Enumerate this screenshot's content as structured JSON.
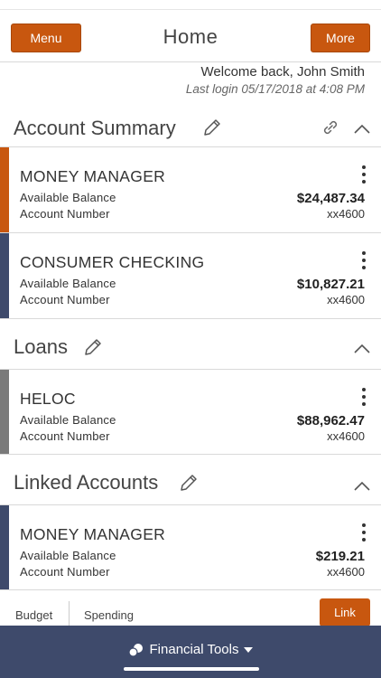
{
  "header": {
    "menu_label": "Menu",
    "title": "Home",
    "more_label": "More"
  },
  "welcome": {
    "greeting": "Welcome back, John Smith",
    "last_login": "Last login 05/17/2018 at 4:08 PM"
  },
  "sections": {
    "summary": {
      "title": "Account Summary",
      "accounts": [
        {
          "name": "MONEY MANAGER",
          "balance_label": "Available Balance",
          "balance": "$24,487.34",
          "account_label": "Account Number",
          "account": "xx4600",
          "color": "#c8570f"
        },
        {
          "name": "CONSUMER CHECKING",
          "balance_label": "Available Balance",
          "balance": "$10,827.21",
          "account_label": "Account Number",
          "account": "xx4600",
          "color": "#3e4a6b"
        }
      ]
    },
    "loans": {
      "title": "Loans",
      "accounts": [
        {
          "name": "HELOC",
          "balance_label": "Available Balance",
          "balance": "$88,962.47",
          "account_label": "Account Number",
          "account": "xx4600",
          "color": "#7a7a7a"
        }
      ]
    },
    "linked": {
      "title": "Linked Accounts",
      "accounts": [
        {
          "name": "MONEY MANAGER",
          "balance_label": "Available Balance",
          "balance": "$219.21",
          "account_label": "Account Number",
          "account": "xx4600",
          "color": "#3e4a6b"
        }
      ]
    }
  },
  "tools": {
    "budget_label": "Budget",
    "spending_label": "Spending",
    "link_label": "Link"
  },
  "footer": {
    "label": "Financial Tools"
  },
  "icons": {
    "edit": "pencil-icon",
    "link": "link-icon",
    "collapse": "chevron-up-icon",
    "more": "kebab-icon",
    "tools": "coins-icon",
    "dropdown": "caret-down-icon"
  },
  "colors": {
    "accent": "#c8570f",
    "navy": "#3e4a6b",
    "gray": "#7a7a7a"
  }
}
